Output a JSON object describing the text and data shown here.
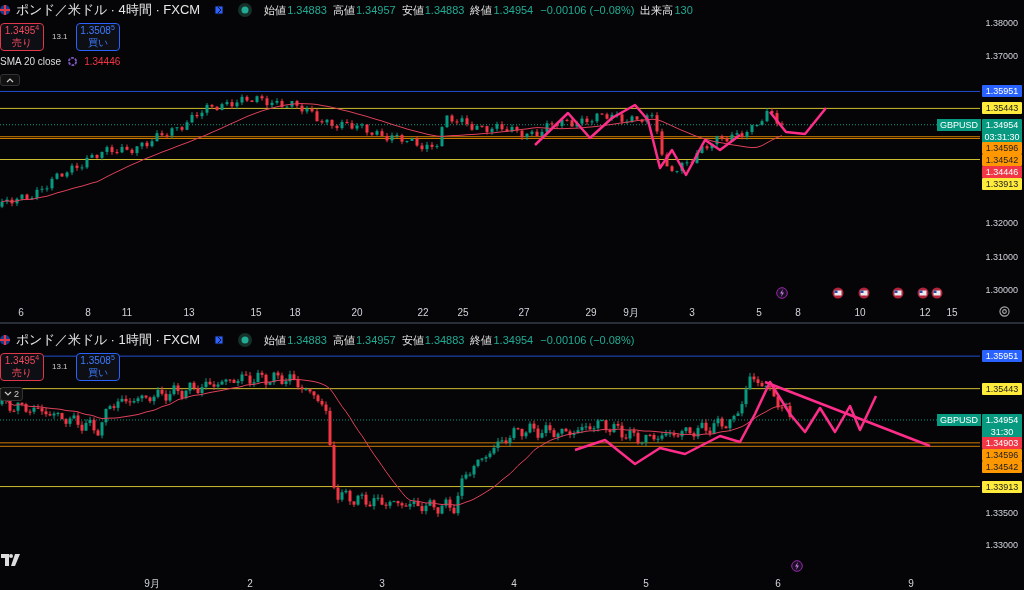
{
  "panes": [
    {
      "title": "ポンド／米ドル · 4時間 · FXCM",
      "ohlc": [
        {
          "label": "始値",
          "value": "1.34883"
        },
        {
          "label": "高値",
          "value": "1.34957"
        },
        {
          "label": "安値",
          "value": "1.34883"
        },
        {
          "label": "終値",
          "value": "1.34954"
        }
      ],
      "change": "−0.00106 (−0.08%)",
      "volume": {
        "label": "出来高",
        "value": "130"
      },
      "sell": {
        "price": "1.3495$^{4}$",
        "label": "売り"
      },
      "spread": "13.1",
      "buy": {
        "price": "1.3508$^{5}$",
        "label": "買い"
      },
      "indicator": {
        "name": "SMA 20 close",
        "value": "1.34446"
      },
      "collapse": {
        "expanded": true
      },
      "axis_ticks": [
        "1.38000",
        "1.37000",
        "1.32000",
        "1.31000",
        "1.30000"
      ],
      "price_labels": [
        {
          "kind": "level",
          "text": "1.35951",
          "color": "#2962ff"
        },
        {
          "kind": "level",
          "text": "1.35443",
          "color": "#ffeb3b"
        },
        {
          "kind": "last",
          "symbol": "GBPUSD",
          "text": "1.34954",
          "countdown": "03:31:30",
          "color": "#089981"
        },
        {
          "kind": "level",
          "text": "1.34596",
          "color": "#ff9800"
        },
        {
          "kind": "level",
          "text": "1.34542",
          "color": "#ff9800"
        },
        {
          "kind": "level",
          "text": "1.34446",
          "color": "#f23645"
        },
        {
          "kind": "level",
          "text": "1.33913",
          "color": "#ffeb3b"
        }
      ],
      "dates": [
        "6",
        "8",
        "11",
        "13",
        "15",
        "18",
        "20",
        "22",
        "25",
        "27",
        "29",
        "9月",
        "3",
        "5",
        "8",
        "10",
        "12",
        "15"
      ]
    },
    {
      "title": "ポンド／米ドル · 1時間 · FXCM",
      "ohlc": [
        {
          "label": "始値",
          "value": "1.34883"
        },
        {
          "label": "高値",
          "value": "1.34957"
        },
        {
          "label": "安値",
          "value": "1.34883"
        },
        {
          "label": "終値",
          "value": "1.34954"
        }
      ],
      "change": "−0.00106 (−0.08%)",
      "sell": {
        "price": "1.3495$^{4}$",
        "label": "売り"
      },
      "spread": "13.1",
      "buy": {
        "price": "1.3508$^{5}$",
        "label": "買い"
      },
      "collapse": {
        "expanded": false,
        "count": "2"
      },
      "axis_ticks": [
        "1.33500",
        "1.33000"
      ],
      "price_labels": [
        {
          "kind": "level",
          "text": "1.35951",
          "color": "#2962ff"
        },
        {
          "kind": "level",
          "text": "1.35443",
          "color": "#ffeb3b"
        },
        {
          "kind": "last",
          "symbol": "GBPUSD",
          "text": "1.34954",
          "countdown": "31:30",
          "color": "#089981"
        },
        {
          "kind": "level",
          "text": "1.34903",
          "color": "#f23645"
        },
        {
          "kind": "level",
          "text": "1.34596",
          "color": "#ff9800"
        },
        {
          "kind": "level",
          "text": "1.34542",
          "color": "#ff9800"
        },
        {
          "kind": "level",
          "text": "1.33913",
          "color": "#ffeb3b"
        }
      ],
      "dates": [
        "9月",
        "2",
        "3",
        "4",
        "5",
        "6",
        "9"
      ]
    }
  ]
}
